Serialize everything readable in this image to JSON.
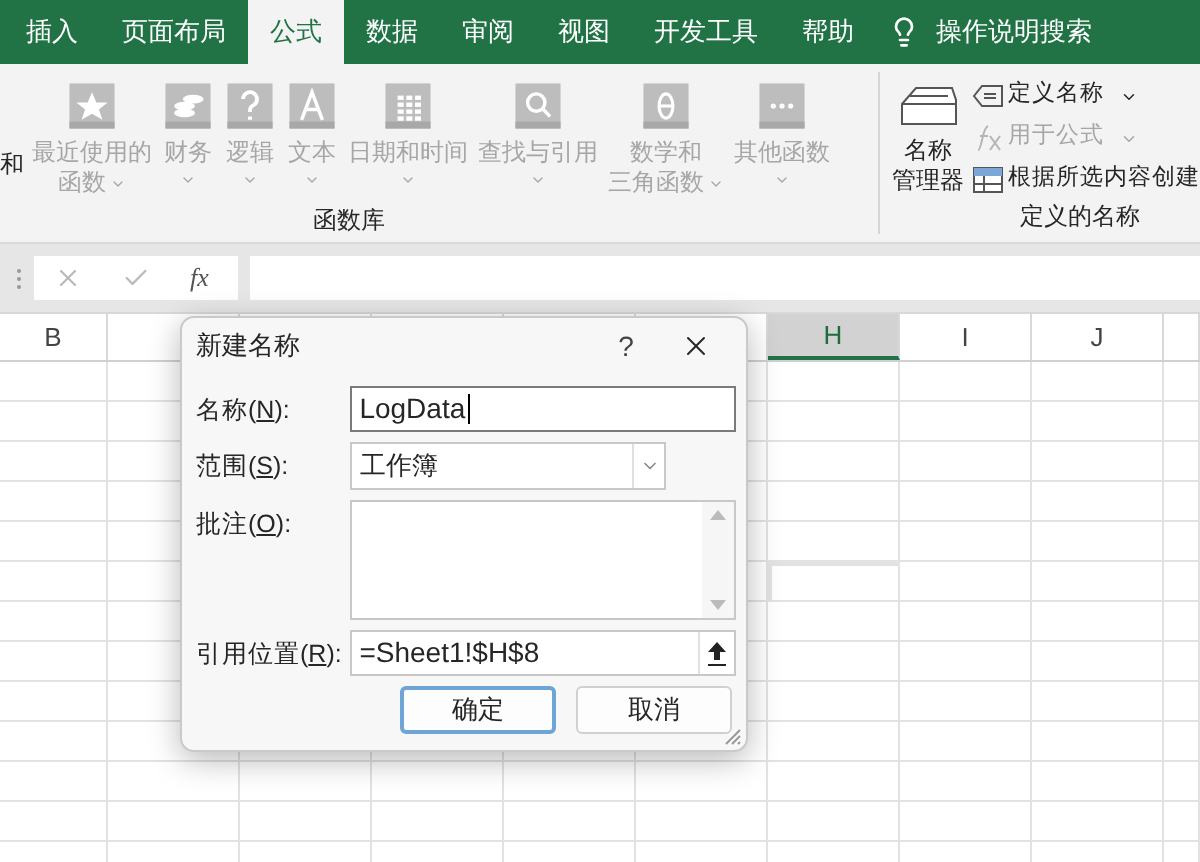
{
  "tabs": [
    {
      "label": "插入",
      "selected": false
    },
    {
      "label": "页面布局",
      "selected": false
    },
    {
      "label": "公式",
      "selected": true
    },
    {
      "label": "数据",
      "selected": false
    },
    {
      "label": "审阅",
      "selected": false
    },
    {
      "label": "视图",
      "selected": false
    },
    {
      "label": "开发工具",
      "selected": false
    },
    {
      "label": "帮助",
      "selected": false
    }
  ],
  "tell_me": "操作说明搜索",
  "ribbon": {
    "cut_label": "和",
    "function_library": {
      "title": "函数库",
      "items": [
        {
          "lines": [
            "最近使用的",
            "函数"
          ],
          "disabled": true
        },
        {
          "lines": [
            "财务"
          ],
          "disabled": true
        },
        {
          "lines": [
            "逻辑"
          ],
          "disabled": true
        },
        {
          "lines": [
            "文本"
          ],
          "disabled": true
        },
        {
          "lines": [
            "日期和时间"
          ],
          "disabled": true
        },
        {
          "lines": [
            "查找与引用"
          ],
          "disabled": true
        },
        {
          "lines": [
            "数学和",
            "三角函数"
          ],
          "disabled": true
        },
        {
          "lines": [
            "其他函数"
          ],
          "disabled": true
        }
      ]
    },
    "defined_names": {
      "title": "定义的名称",
      "manager": [
        "名称",
        "管理器"
      ],
      "items": [
        {
          "label": "定义名称",
          "dropdown": true,
          "disabled": false
        },
        {
          "label": "用于公式",
          "dropdown": true,
          "disabled": true
        },
        {
          "label": "根据所选内容创建",
          "dropdown": false,
          "disabled": false
        }
      ]
    }
  },
  "formula_bar": {
    "function_button": "fx"
  },
  "columns": [
    {
      "label": "B",
      "selected": false
    },
    {
      "selected": false
    },
    {
      "selected": false
    },
    {
      "selected": false
    },
    {
      "selected": false
    },
    {
      "selected": false
    },
    {
      "label": "H",
      "selected": true
    },
    {
      "label": "I",
      "selected": false
    },
    {
      "label": "J",
      "selected": false
    },
    {
      "selected": false
    }
  ],
  "dialog": {
    "title": "新建名称",
    "help": "?",
    "fields": [
      {
        "kind": "text",
        "label": "名称(N):",
        "value": "LogData",
        "focused": true
      },
      {
        "kind": "select",
        "label": "范围(S):",
        "value": "工作簿",
        "focused": false
      },
      {
        "kind": "textarea",
        "label": "批注(O):",
        "focused": false
      },
      {
        "kind": "reference",
        "label": "引用位置(R):",
        "value": "=Sheet1!$H$8",
        "focused": false
      }
    ],
    "buttons": [
      {
        "label": "确定",
        "default": true
      },
      {
        "label": "取消",
        "default": false
      }
    ]
  }
}
